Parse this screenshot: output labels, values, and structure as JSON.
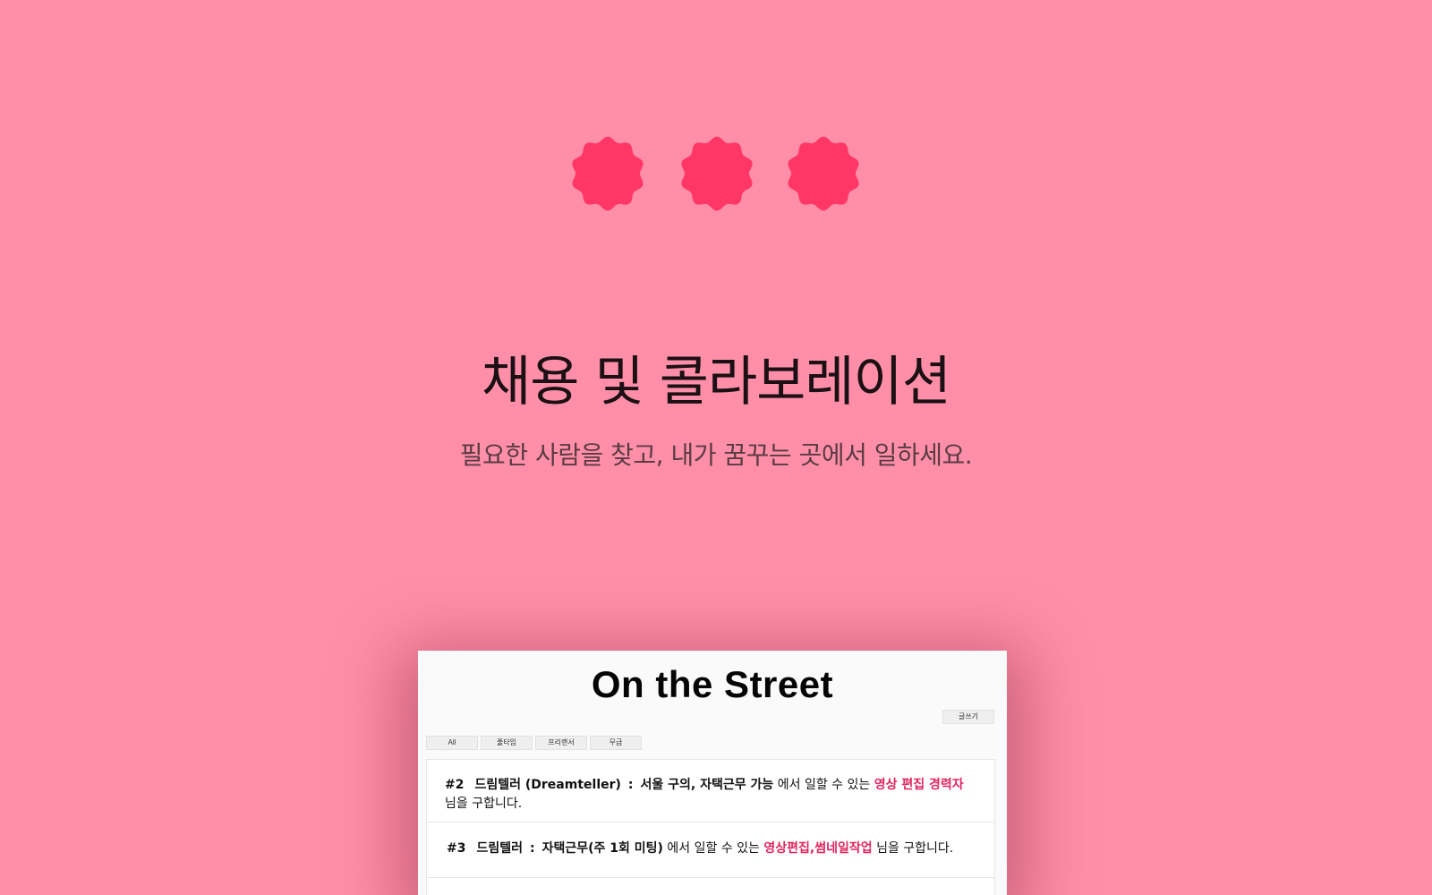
{
  "colors": {
    "background": "#ff8fa8",
    "badge": "#ff3766",
    "highlight": "#e0245e"
  },
  "badges": [
    {
      "icon": "scalloped-badge-icon"
    },
    {
      "icon": "scalloped-badge-icon"
    },
    {
      "icon": "scalloped-badge-icon"
    }
  ],
  "hero": {
    "title": "채용 및 콜라보레이션",
    "subtitle": "필요한 사람을 찾고, 내가 꿈꾸는 곳에서 일하세요."
  },
  "preview": {
    "brand": "On the Street",
    "write_button": "글쓰기",
    "filters": [
      "All",
      "풀타임",
      "프리랜서",
      "무급"
    ],
    "posts": [
      {
        "number": "#2",
        "company": "드림텔러 (Dreamteller)",
        "separator": ":",
        "place": "서울 구의, 자택근무 가능",
        "middle": " 에서 일할 수 있는 ",
        "role": "영상 편집 경력자",
        "ending": " 님을 구합니다."
      },
      {
        "number": "#3",
        "company": "드림텔러",
        "separator": ":",
        "place": "자택근무(주 1회 미팅)",
        "middle": " 에서 일할 수 있는 ",
        "role": "영상편집,썸네일작업",
        "ending": " 님을 구합니다."
      }
    ]
  }
}
